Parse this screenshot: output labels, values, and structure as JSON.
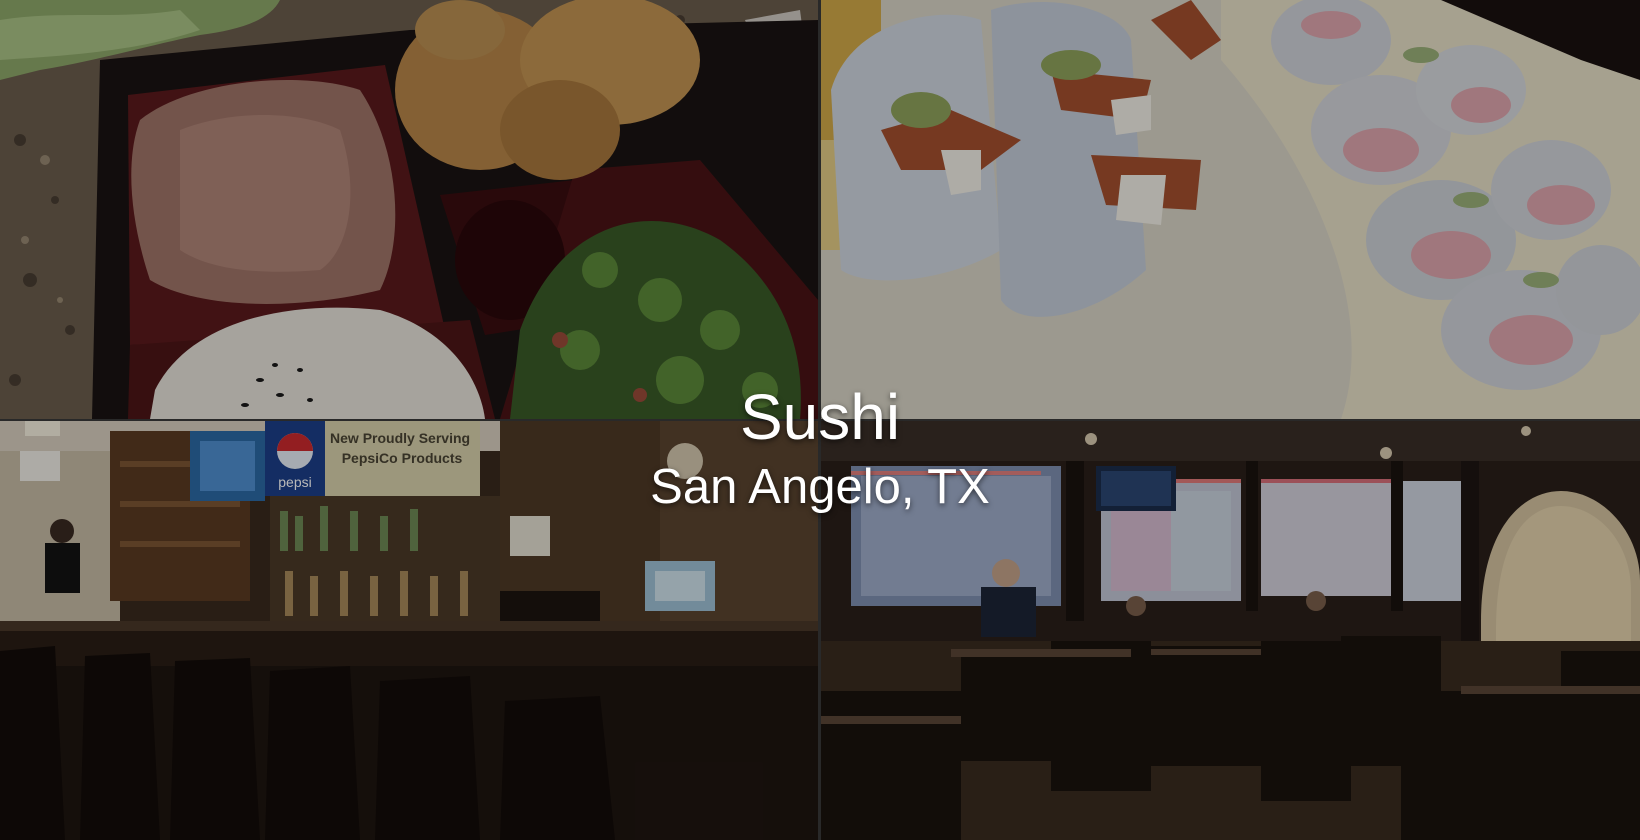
{
  "heading": {
    "title": "Sushi",
    "subtitle": "San Angelo, TX"
  },
  "photos": [
    {
      "name": "bento-box-photo"
    },
    {
      "name": "sushi-rolls-photo"
    },
    {
      "name": "bar-interior-photo",
      "sign_text": "New Proudly Serving PepsiCo Products",
      "logo_text": "pepsi"
    },
    {
      "name": "dining-room-photo"
    }
  ],
  "colors": {
    "overlay": "#000000",
    "text": "#ffffff"
  }
}
